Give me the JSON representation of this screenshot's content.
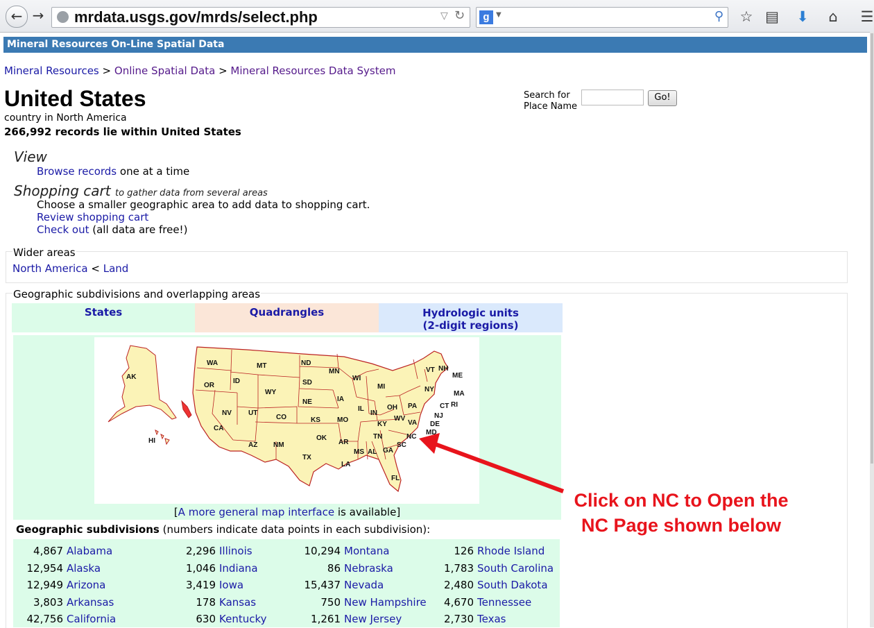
{
  "browser": {
    "url": "mrdata.usgs.gov/mrds/select.php",
    "search_engine": "g",
    "back_icon": "back-arrow-icon",
    "forward_icon": "forward-arrow-icon"
  },
  "banner": "Mineral Resources On-Line Spatial Data",
  "breadcrumb": [
    {
      "label": "Mineral Resources",
      "visited": false
    },
    {
      "label": "Online Spatial Data",
      "visited": true
    },
    {
      "label": "Mineral Resources Data System",
      "visited": true
    }
  ],
  "breadcrumb_sep": ">",
  "place": {
    "title": "United States",
    "subtitle": "country in North America",
    "records": "266,992 records lie within United States"
  },
  "search": {
    "label_line1": "Search for",
    "label_line2": "Place Name",
    "value": "",
    "go": "Go!"
  },
  "view": {
    "heading": "View",
    "browse_link": "Browse records",
    "browse_rest": " one at a time"
  },
  "cart": {
    "heading": "Shopping cart",
    "subheading": "to gather data from several areas",
    "instruction": "Choose a smaller geographic area to add data to shopping cart.",
    "review_link": "Review shopping cart",
    "checkout_link": "Check out",
    "checkout_rest": " (all data are free!)"
  },
  "wider": {
    "heading": "Wider areas",
    "link1": "North America",
    "sep": " < ",
    "link2": "Land"
  },
  "subdivisions": {
    "heading": "Geographic subdivisions and overlapping areas",
    "tabs": [
      {
        "label": "States",
        "color": "#dcfce9"
      },
      {
        "label": "Quadrangles",
        "color": "#fbe6d8"
      },
      {
        "label": "Hydrologic units",
        "label2": "(2-digit regions)",
        "color": "#dae9fc"
      }
    ],
    "map_link_pre": "[",
    "map_link": "A more general map interface",
    "map_link_post": " is available]",
    "table_title_bold": "Geographic subdivisions",
    "table_title_rest": " (numbers indicate data points in each subdivision):",
    "columns": [
      [
        [
          "4,867",
          "Alabama"
        ],
        [
          "12,954",
          "Alaska"
        ],
        [
          "12,949",
          "Arizona"
        ],
        [
          "3,803",
          "Arkansas"
        ],
        [
          "42,756",
          "California"
        ]
      ],
      [
        [
          "2,296",
          "Illinois"
        ],
        [
          "1,046",
          "Indiana"
        ],
        [
          "3,419",
          "Iowa"
        ],
        [
          "178",
          "Kansas"
        ],
        [
          "630",
          "Kentucky"
        ]
      ],
      [
        [
          "10,294",
          "Montana"
        ],
        [
          "86",
          "Nebraska"
        ],
        [
          "15,437",
          "Nevada"
        ],
        [
          "750",
          "New Hampshire"
        ],
        [
          "1,261",
          "New Jersey"
        ]
      ],
      [
        [
          "126",
          "Rhode Island"
        ],
        [
          "1,783",
          "South Carolina"
        ],
        [
          "2,480",
          "South Dakota"
        ],
        [
          "4,670",
          "Tennessee"
        ],
        [
          "2,730",
          "Texas"
        ]
      ]
    ]
  },
  "map_states": [
    "AK",
    "HI",
    "WA",
    "OR",
    "CA",
    "ID",
    "MT",
    "WY",
    "NV",
    "UT",
    "AZ",
    "CO",
    "NM",
    "ND",
    "SD",
    "NE",
    "KS",
    "OK",
    "TX",
    "MN",
    "IA",
    "MO",
    "AR",
    "LA",
    "WI",
    "IL",
    "MI",
    "IN",
    "OH",
    "KY",
    "TN",
    "MS",
    "AL",
    "GA",
    "FL",
    "SC",
    "NC",
    "VA",
    "WV",
    "PA",
    "NY",
    "VT",
    "NH",
    "ME",
    "MA",
    "RI",
    "CT",
    "NJ",
    "DE",
    "MD"
  ],
  "annotation": {
    "line1": "Click on NC to Open the",
    "line2": "NC Page shown below",
    "color": "#e8141c"
  }
}
